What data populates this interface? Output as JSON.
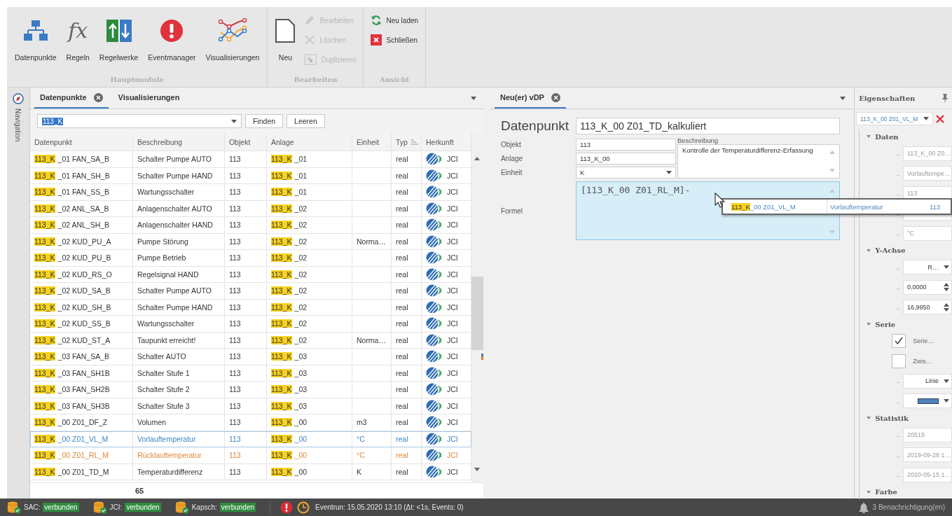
{
  "ribbon": {
    "groups": [
      {
        "title": "Hauptmodule",
        "buttons": [
          {
            "kind": "hierarchy",
            "label": "Datenpunkte"
          },
          {
            "kind": "formula",
            "label": "Regeln",
            "glyph": "fx"
          },
          {
            "kind": "rulesets",
            "label": "Regelwerke"
          },
          {
            "kind": "alert",
            "label": "Eventmanager"
          },
          {
            "kind": "chart",
            "label": "Visualisierungen"
          }
        ]
      },
      {
        "title": "Bearbeiten",
        "buttons": [
          {
            "kind": "new",
            "label": "Neu"
          }
        ],
        "small": [
          {
            "kind": "edit",
            "label": "Bearbeiten",
            "disabled": true
          },
          {
            "kind": "delete",
            "label": "Löschen",
            "disabled": true
          },
          {
            "kind": "duplicate",
            "label": "Duplizieren",
            "disabled": true
          }
        ]
      },
      {
        "title": "Ansicht",
        "small": [
          {
            "kind": "reload",
            "label": "Neu laden",
            "disabled": false
          },
          {
            "kind": "close",
            "label": "Schließen",
            "disabled": false
          }
        ]
      }
    ]
  },
  "navigation": {
    "label": "Navigation"
  },
  "left_panel": {
    "tabs": [
      {
        "label": "Datenpunkte",
        "selected": true,
        "closable": true
      },
      {
        "label": "Visualisierungen",
        "selected": false,
        "closable": false
      }
    ],
    "search": {
      "value": "113_K"
    },
    "buttons": [
      "Finden",
      "Leeren"
    ],
    "table": {
      "columns": [
        {
          "label": "Datenpunkt",
          "sorted": false
        },
        {
          "label": "Beschreibung",
          "sorted": false
        },
        {
          "label": "Objekt",
          "sorted": false
        },
        {
          "label": "Anlage",
          "sorted": false
        },
        {
          "label": "Einheit",
          "sorted": false
        },
        {
          "label": "Typ",
          "sorted": true
        },
        {
          "label": "Herkunft",
          "sorted": false
        }
      ],
      "rows": [
        {
          "datenpunkt": {
            "match": "113_K",
            "rest": "_01 FAN_SA_B"
          },
          "beschreibung": "Schalter Pumpe AUTO",
          "objekt": "113",
          "anlage": {
            "match": "113_K",
            "rest": "_01"
          },
          "einheit": "",
          "typ": "real",
          "herkunft": "JCI",
          "selected": false,
          "marked": false
        },
        {
          "datenpunkt": {
            "match": "113_K",
            "rest": "_01 FAN_SH_B"
          },
          "beschreibung": "Schalter Pumpe HAND",
          "objekt": "113",
          "anlage": {
            "match": "113_K",
            "rest": "_01"
          },
          "einheit": "",
          "typ": "real",
          "herkunft": "JCI",
          "selected": false,
          "marked": false
        },
        {
          "datenpunkt": {
            "match": "113_K",
            "rest": "_01 FAN_SS_B"
          },
          "beschreibung": "Wartungsschalter",
          "objekt": "113",
          "anlage": {
            "match": "113_K",
            "rest": "_01"
          },
          "einheit": "",
          "typ": "real",
          "herkunft": "JCI",
          "selected": false,
          "marked": false
        },
        {
          "datenpunkt": {
            "match": "113_K",
            "rest": "_02 ANL_SA_B"
          },
          "beschreibung": "Anlagenschalter AUTO",
          "objekt": "113",
          "anlage": {
            "match": "113_K",
            "rest": "_02"
          },
          "einheit": "",
          "typ": "real",
          "herkunft": "JCI",
          "selected": false,
          "marked": false
        },
        {
          "datenpunkt": {
            "match": "113_K",
            "rest": "_02 ANL_SH_B"
          },
          "beschreibung": "Anlagenschalter HAND",
          "objekt": "113",
          "anlage": {
            "match": "113_K",
            "rest": "_02"
          },
          "einheit": "",
          "typ": "real",
          "herkunft": "JCI",
          "selected": false,
          "marked": false
        },
        {
          "datenpunkt": {
            "match": "113_K",
            "rest": "_02 KUD_PU_A"
          },
          "beschreibung": "Pumpe Störung",
          "objekt": "113",
          "anlage": {
            "match": "113_K",
            "rest": "_02"
          },
          "einheit": "Norma…",
          "typ": "real",
          "herkunft": "JCI",
          "selected": false,
          "marked": false
        },
        {
          "datenpunkt": {
            "match": "113_K",
            "rest": "_02 KUD_PU_B"
          },
          "beschreibung": "Pumpe Betrieb",
          "objekt": "113",
          "anlage": {
            "match": "113_K",
            "rest": "_02"
          },
          "einheit": "",
          "typ": "real",
          "herkunft": "JCI",
          "selected": false,
          "marked": false
        },
        {
          "datenpunkt": {
            "match": "113_K",
            "rest": "_02 KUD_RS_O"
          },
          "beschreibung": "Regelsignal HAND",
          "objekt": "113",
          "anlage": {
            "match": "113_K",
            "rest": "_02"
          },
          "einheit": "",
          "typ": "real",
          "herkunft": "JCI",
          "selected": false,
          "marked": false
        },
        {
          "datenpunkt": {
            "match": "113_K",
            "rest": "_02 KUD_SA_B"
          },
          "beschreibung": "Schalter Pumpe AUTO",
          "objekt": "113",
          "anlage": {
            "match": "113_K",
            "rest": "_02"
          },
          "einheit": "",
          "typ": "real",
          "herkunft": "JCI",
          "selected": false,
          "marked": false
        },
        {
          "datenpunkt": {
            "match": "113_K",
            "rest": "_02 KUD_SH_B"
          },
          "beschreibung": "Schalter Pumpe HAND",
          "objekt": "113",
          "anlage": {
            "match": "113_K",
            "rest": "_02"
          },
          "einheit": "",
          "typ": "real",
          "herkunft": "JCI",
          "selected": false,
          "marked": false
        },
        {
          "datenpunkt": {
            "match": "113_K",
            "rest": "_02 KUD_SS_B"
          },
          "beschreibung": "Wartungsschalter",
          "objekt": "113",
          "anlage": {
            "match": "113_K",
            "rest": "_02"
          },
          "einheit": "",
          "typ": "real",
          "herkunft": "JCI",
          "selected": false,
          "marked": false
        },
        {
          "datenpunkt": {
            "match": "113_K",
            "rest": "_02 KUD_ST_A"
          },
          "beschreibung": "Taupunkt erreicht!",
          "objekt": "113",
          "anlage": {
            "match": "113_K",
            "rest": "_02"
          },
          "einheit": "Norma…",
          "typ": "real",
          "herkunft": "JCI",
          "selected": false,
          "marked": false
        },
        {
          "datenpunkt": {
            "match": "113_K",
            "rest": "_03 FAN_SA_B"
          },
          "beschreibung": "Schalter AUTO",
          "objekt": "113",
          "anlage": {
            "match": "113_K",
            "rest": "_03"
          },
          "einheit": "",
          "typ": "real",
          "herkunft": "JCI",
          "selected": false,
          "marked": false
        },
        {
          "datenpunkt": {
            "match": "113_K",
            "rest": "_03 FAN_SH1B"
          },
          "beschreibung": "Schalter Stufe 1",
          "objekt": "113",
          "anlage": {
            "match": "113_K",
            "rest": "_03"
          },
          "einheit": "",
          "typ": "real",
          "herkunft": "JCI",
          "selected": false,
          "marked": false
        },
        {
          "datenpunkt": {
            "match": "113_K",
            "rest": "_03 FAN_SH2B"
          },
          "beschreibung": "Schalter Stufe 2",
          "objekt": "113",
          "anlage": {
            "match": "113_K",
            "rest": "_03"
          },
          "einheit": "",
          "typ": "real",
          "herkunft": "JCI",
          "selected": false,
          "marked": false
        },
        {
          "datenpunkt": {
            "match": "113_K",
            "rest": "_03 FAN_SH3B"
          },
          "beschreibung": "Schalter Stufe 3",
          "objekt": "113",
          "anlage": {
            "match": "113_K",
            "rest": "_03"
          },
          "einheit": "",
          "typ": "real",
          "herkunft": "JCI",
          "selected": false,
          "marked": false
        },
        {
          "datenpunkt": {
            "match": "113_K",
            "rest": "_00 Z01_DF_Z"
          },
          "beschreibung": "Volumen",
          "objekt": "113",
          "anlage": {
            "match": "113_K",
            "rest": "_00"
          },
          "einheit": "m3",
          "typ": "real",
          "herkunft": "JCI",
          "selected": false,
          "marked": false
        },
        {
          "datenpunkt": {
            "match": "113_K",
            "rest": "_00 Z01_VL_M"
          },
          "beschreibung": "Vorlauftemperatur",
          "objekt": "113",
          "anlage": {
            "match": "113_K",
            "rest": "_00"
          },
          "einheit": "°C",
          "typ": "real",
          "herkunft": "JCI",
          "selected": true,
          "marked": false
        },
        {
          "datenpunkt": {
            "match": "113_K",
            "rest": "_00 Z01_RL_M"
          },
          "beschreibung": "Rücklauftemperatur",
          "objekt": "113",
          "anlage": {
            "match": "113_K",
            "rest": "_00"
          },
          "einheit": "°C",
          "typ": "real",
          "herkunft": "JCI",
          "selected": false,
          "marked": true
        },
        {
          "datenpunkt": {
            "match": "113_K",
            "rest": "_00 Z01_TD_M"
          },
          "beschreibung": "Temperaturdifferenz",
          "objekt": "113",
          "anlage": {
            "match": "113_K",
            "rest": "_00"
          },
          "einheit": "K",
          "typ": "real",
          "herkunft": "JCI",
          "selected": false,
          "marked": false
        }
      ]
    },
    "count": "65"
  },
  "editor": {
    "tabs": [
      {
        "label": "Neu(er) vDP",
        "selected": true,
        "closable": true
      }
    ],
    "title_label": "Datenpunkt",
    "name": "113_K_00 Z01_TD_kalkuliert",
    "fields": [
      {
        "label": "Objekt",
        "value": "113",
        "kind": "text"
      },
      {
        "label": "Anlage",
        "value": "113_K_00",
        "kind": "text"
      },
      {
        "label": "Einheit",
        "value": "K",
        "kind": "dropdown"
      }
    ],
    "description": {
      "label": "Beschreibung",
      "value": "Kontrolle der Temperaturdifferenz-Erfassung"
    },
    "formula": {
      "label": "Formel",
      "value": "[113_K_00 Z01_RL_M]-"
    },
    "suggestion": {
      "datenpunkt": {
        "match": "113_K",
        "rest": "_00 Z01_VL_M"
      },
      "beschreibung": "Vorlauftemperatur",
      "objekt": "113"
    }
  },
  "properties": {
    "title": "Eigenschaften",
    "object": "113_K_00 Z01_VL_M",
    "sections": [
      {
        "title": "Daten",
        "items": [
          {
            "kind": "text",
            "label": "..",
            "value": "113_K_00 Z0…",
            "disabled": true
          },
          {
            "kind": "text",
            "label": "..",
            "value": "Vorlauftempe…",
            "disabled": true
          },
          {
            "kind": "text",
            "label": "..",
            "value": "113",
            "disabled": true
          },
          {
            "kind": "text",
            "label": ".."
          },
          {
            "kind": "text",
            "label": "..",
            "value": "°C",
            "disabled": true
          }
        ]
      },
      {
        "title": "Y-Achse",
        "items": [
          {
            "kind": "dropdown",
            "label": "..",
            "value": "R…"
          },
          {
            "kind": "spin",
            "label": "..",
            "value": "0,0000"
          },
          {
            "kind": "spin",
            "label": "..",
            "value": "16,9950"
          }
        ]
      },
      {
        "title": "Serie",
        "items": [
          {
            "kind": "check",
            "value": "Serie…",
            "checked": true
          },
          {
            "kind": "check",
            "value": "Zwis…",
            "checked": false
          },
          {
            "kind": "dropdown",
            "label": "..",
            "value": "Linie"
          },
          {
            "kind": "color",
            "label": "..",
            "color": "#4f81bd"
          }
        ]
      },
      {
        "title": "Statistik",
        "items": [
          {
            "kind": "text",
            "label": "..",
            "value": "20515",
            "disabled": true
          },
          {
            "kind": "text",
            "label": "..",
            "value": "2019-09-28 1…",
            "disabled": true
          },
          {
            "kind": "text",
            "label": "..",
            "value": "2020-05-15 1…",
            "disabled": true
          }
        ]
      },
      {
        "title": "Farbe"
      }
    ]
  },
  "status_bar": {
    "connections": [
      {
        "label": "SAC:",
        "status": "verbunden"
      },
      {
        "label": "JCI:",
        "status": "verbunden"
      },
      {
        "label": "Kapsch:",
        "status": "verbunden"
      }
    ],
    "event": "Eventrun: 15.05.2020 13:10 (Δt: <1s, Events: 0)",
    "notifications": "3 Benachrichtigung(en)"
  }
}
